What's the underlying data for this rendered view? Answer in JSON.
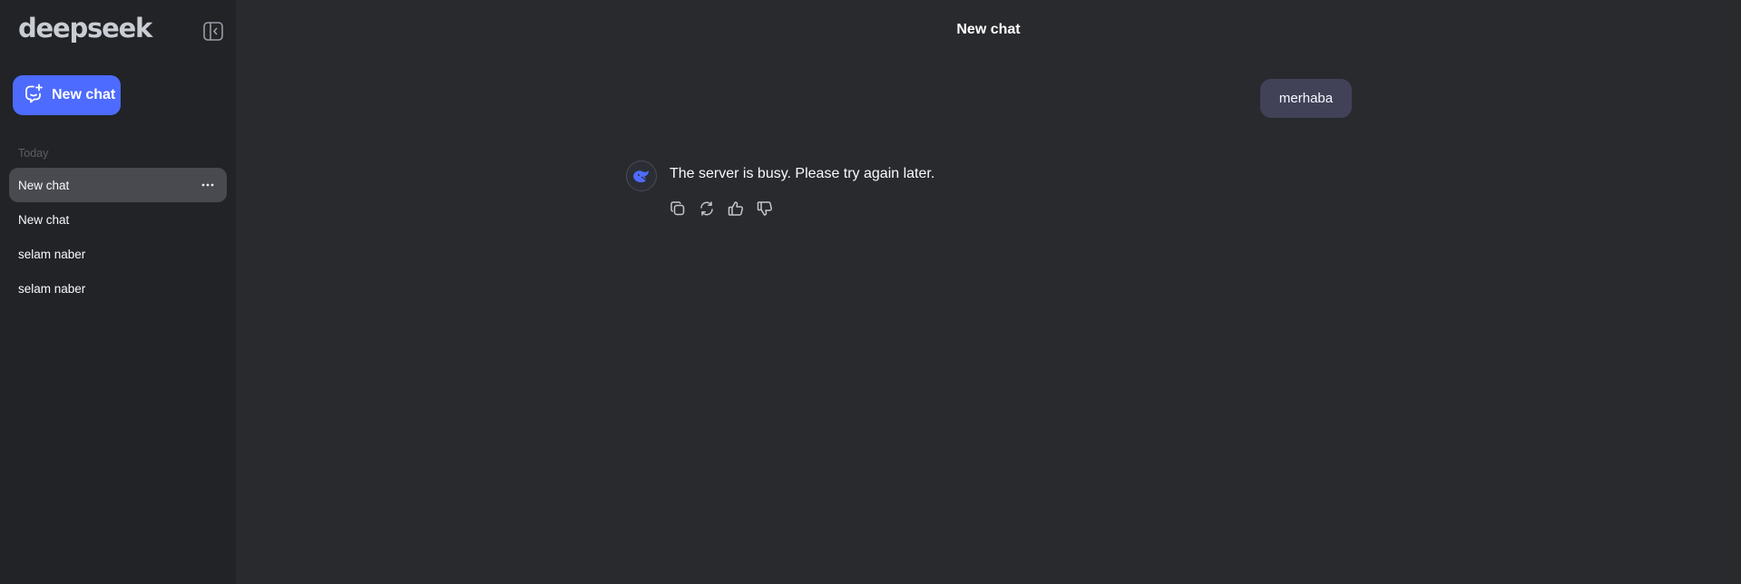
{
  "sidebar": {
    "logo": "deepseek",
    "new_chat_label": "New chat",
    "section_label": "Today",
    "items": [
      {
        "label": "New chat",
        "active": true
      },
      {
        "label": "New chat"
      },
      {
        "label": "selam naber"
      },
      {
        "label": "selam naber"
      }
    ]
  },
  "main": {
    "title": "New chat",
    "user_message": "merhaba",
    "assistant_message": "The server is busy. Please try again later."
  },
  "colors": {
    "accent": "#4d6bfe",
    "sidebar_bg": "#212327",
    "main_bg": "#292a2d",
    "user_bubble": "#414158",
    "active_item": "#484a4f"
  },
  "icons": {
    "collapse": "sidebar-collapse-icon",
    "new_chat": "chat-plus-icon",
    "more": "more-horizontal-icon",
    "avatar": "deepseek-whale-icon",
    "copy": "copy-icon",
    "regenerate": "refresh-icon",
    "like": "thumbs-up-icon",
    "dislike": "thumbs-down-icon"
  }
}
